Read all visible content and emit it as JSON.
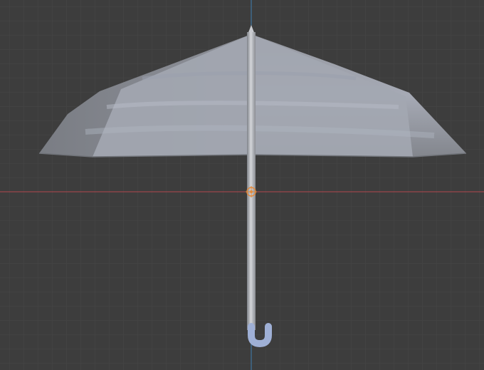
{
  "viewport": {
    "background_color": "#3d3d3d",
    "grid_minor_color": "#474747",
    "grid_major_color": "#505050",
    "x_axis_color": "#b3474d",
    "y_axis_color": "#3f7fb3"
  },
  "scene": {
    "object": "umbrella",
    "canopy_colors": [
      "#8c8f96",
      "#a9adb8",
      "#767980"
    ],
    "shaft_colors": [
      "#7f8288",
      "#d4d6da",
      "#8a8d93"
    ],
    "handle_color": "#9fb0d6",
    "origin_marker_color": "#e38a3c",
    "icons": [
      "object-origin-icon"
    ]
  }
}
